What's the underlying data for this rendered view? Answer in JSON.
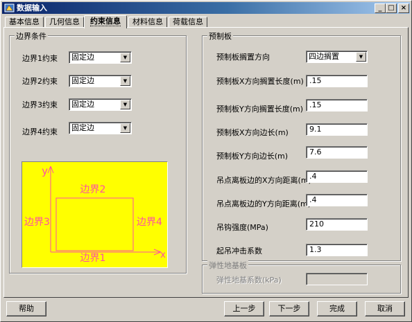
{
  "window": {
    "title": "数据输入",
    "controls": [
      "_",
      "□",
      "×"
    ]
  },
  "tabs": [
    {
      "label": "基本信息",
      "active": false
    },
    {
      "label": "几何信息",
      "active": false
    },
    {
      "label": "约束信息",
      "active": true
    },
    {
      "label": "材料信息",
      "active": false
    },
    {
      "label": "荷载信息",
      "active": false
    }
  ],
  "boundary": {
    "legend": "边界条件",
    "rows": [
      {
        "label": "边界1约束",
        "value": "固定边"
      },
      {
        "label": "边界2约束",
        "value": "固定边"
      },
      {
        "label": "边界3约束",
        "value": "固定边"
      },
      {
        "label": "边界4约束",
        "value": "固定边"
      }
    ],
    "diagram": {
      "axis_y": "y",
      "axis_x": "x",
      "edge_top": "边界2",
      "edge_bottom": "边界1",
      "edge_left": "边界3",
      "edge_right": "边界4",
      "colors": {
        "background": "#ffff00",
        "lines": "#ff4fa3"
      }
    }
  },
  "precast": {
    "legend": "预制板",
    "placement_label": "预制板搁置方向",
    "placement_value": "四边搁置",
    "fields": [
      {
        "label": "预制板X方向搁置长度(m)",
        "value": ".15"
      },
      {
        "label": "预制板Y方向搁置长度(m)",
        "value": ".15"
      },
      {
        "label": "预制板X方向边长(m)",
        "value": "9.1"
      },
      {
        "label": "预制板Y方向边长(m)",
        "value": "7.6"
      },
      {
        "label": "吊点离板边的X方向距离(m)",
        "value": ".4"
      },
      {
        "label": "吊点离板边的Y方向距离(m)",
        "value": ".4"
      },
      {
        "label": "吊钩强度(MPa)",
        "value": "210"
      },
      {
        "label": "起吊冲击系数",
        "value": "1.3"
      }
    ]
  },
  "foundation": {
    "legend": "弹性地基板",
    "label": "弹性地基系数(kPa)",
    "value": ""
  },
  "buttons": {
    "help": "帮助",
    "prev": "上一步",
    "next": "下一步",
    "finish": "完成",
    "cancel": "取消"
  }
}
